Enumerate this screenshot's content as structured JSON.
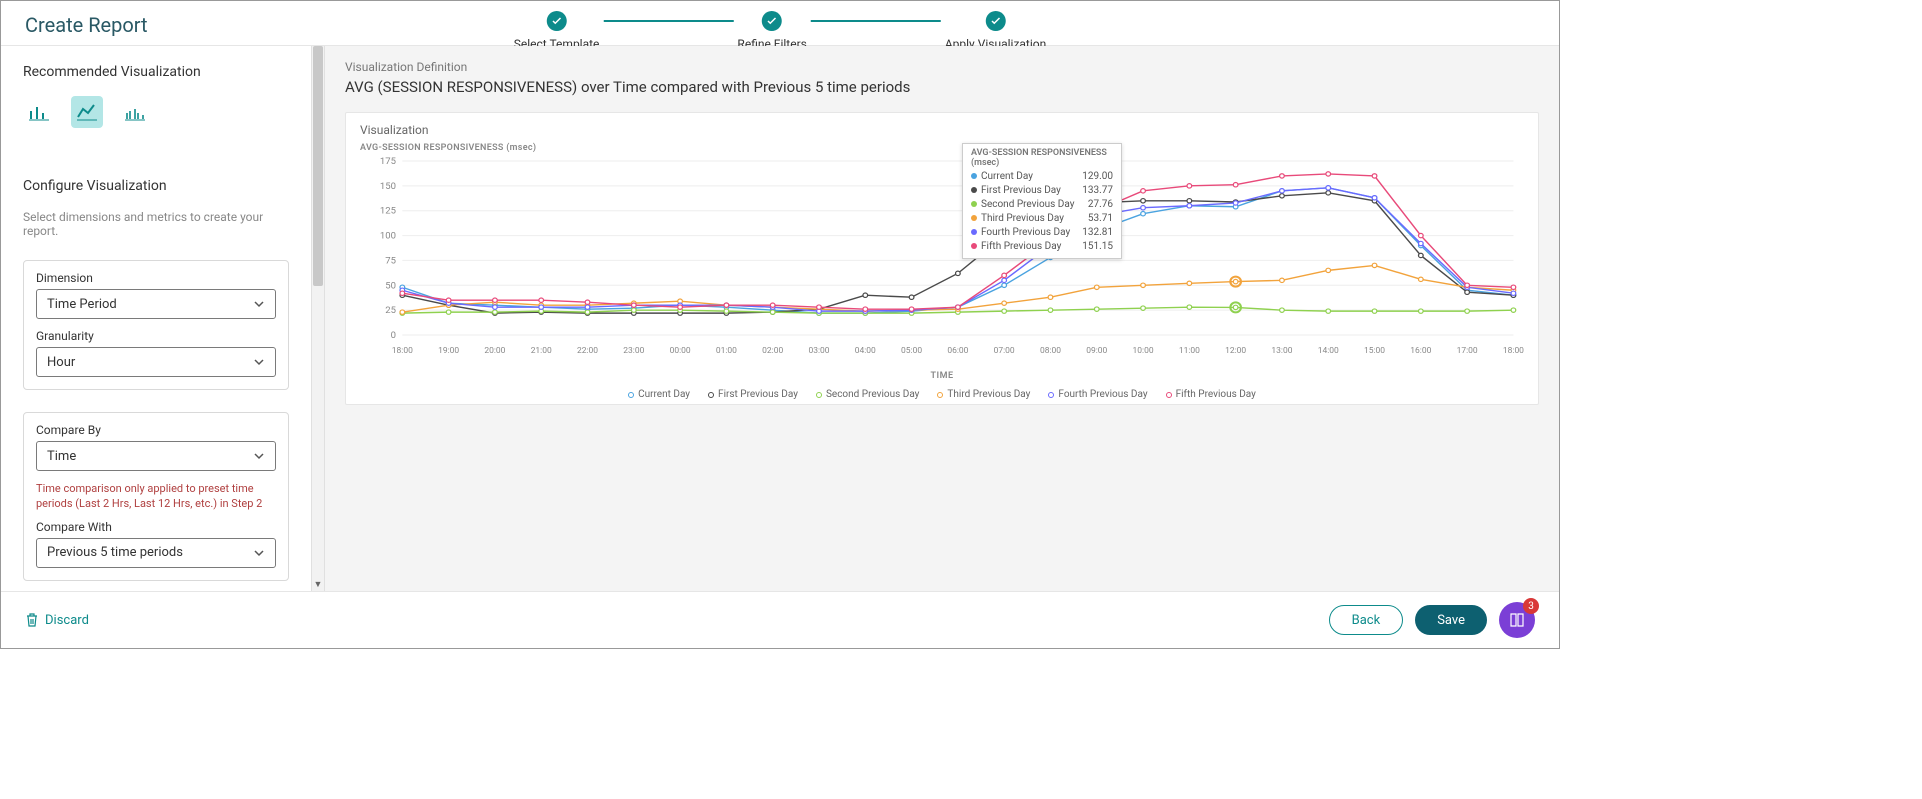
{
  "header": {
    "title": "Create Report",
    "steps": [
      "Select Template",
      "Refine Filters",
      "Apply Visualization"
    ]
  },
  "sidebar": {
    "recommended_label": "Recommended Visualization",
    "configure_heading": "Configure Visualization",
    "configure_sub": "Select dimensions and metrics to create your report.",
    "dimension_label": "Dimension",
    "dimension_value": "Time Period",
    "granularity_label": "Granularity",
    "granularity_value": "Hour",
    "compare_by_label": "Compare By",
    "compare_by_value": "Time",
    "warn_text": "Time comparison only applied to preset time periods (Last 2 Hrs, Last 12 Hrs, etc.) in Step 2",
    "compare_with_label": "Compare With",
    "compare_with_value": "Previous 5 time periods"
  },
  "main": {
    "def_label": "Visualization Definition",
    "def_text": "AVG (SESSION RESPONSIVENESS) over Time compared with Previous 5 time periods",
    "viz_label": "Visualization",
    "y_axis": "AVG-SESSION RESPONSIVENESS (msec)",
    "x_axis": "TIME"
  },
  "tooltip": {
    "title": "AVG-SESSION RESPONSIVENESS (msec)",
    "rows": [
      {
        "label": "Current Day",
        "value": "129.00"
      },
      {
        "label": "First Previous Day",
        "value": "133.77"
      },
      {
        "label": "Second Previous Day",
        "value": "27.76"
      },
      {
        "label": "Third Previous Day",
        "value": "53.71"
      },
      {
        "label": "Fourth Previous Day",
        "value": "132.81"
      },
      {
        "label": "Fifth Previous Day",
        "value": "151.15"
      }
    ]
  },
  "legend": [
    "Current Day",
    "First Previous Day",
    "Second Previous Day",
    "Third Previous Day",
    "Fourth Previous Day",
    "Fifth Previous Day"
  ],
  "footer": {
    "discard": "Discard",
    "back": "Back",
    "save": "Save",
    "badge": "3"
  },
  "colors": {
    "current": "#4aa3e0",
    "first": "#4a4a4a",
    "second": "#8fd14f",
    "third": "#f2a33c",
    "fourth": "#6a6aff",
    "fifth": "#e84a7a"
  },
  "chart_data": {
    "type": "line",
    "title": "",
    "xlabel": "TIME",
    "ylabel": "AVG-SESSION RESPONSIVENESS (msec)",
    "ylim": [
      0,
      175
    ],
    "y_ticks": [
      0,
      25,
      50,
      75,
      100,
      125,
      150,
      175
    ],
    "categories": [
      "18:00",
      "19:00",
      "20:00",
      "21:00",
      "22:00",
      "23:00",
      "00:00",
      "01:00",
      "02:00",
      "03:00",
      "04:00",
      "05:00",
      "06:00",
      "07:00",
      "08:00",
      "09:00",
      "10:00",
      "11:00",
      "12:00",
      "13:00",
      "14:00",
      "15:00",
      "16:00",
      "17:00",
      "18:00"
    ],
    "series": [
      {
        "name": "Current Day",
        "color_key": "current",
        "values": [
          48,
          32,
          30,
          28,
          26,
          27,
          30,
          28,
          25,
          22,
          22,
          24,
          28,
          50,
          78,
          105,
          122,
          130,
          129,
          145,
          148,
          138,
          90,
          45,
          40
        ]
      },
      {
        "name": "First Previous Day",
        "color_key": "first",
        "values": [
          40,
          30,
          22,
          23,
          22,
          22,
          22,
          22,
          23,
          26,
          40,
          38,
          62,
          100,
          125,
          133,
          135,
          135,
          133.77,
          140,
          143,
          135,
          80,
          43,
          40
        ]
      },
      {
        "name": "Second Previous Day",
        "color_key": "second",
        "values": [
          22,
          23,
          23,
          24,
          23,
          25,
          25,
          24,
          23,
          22,
          22,
          22,
          23,
          24,
          25,
          26,
          27,
          28,
          27.76,
          25,
          24,
          24,
          24,
          24,
          25
        ]
      },
      {
        "name": "Third Previous Day",
        "color_key": "third",
        "values": [
          23,
          30,
          33,
          30,
          30,
          32,
          34,
          30,
          28,
          26,
          24,
          25,
          26,
          32,
          38,
          48,
          50,
          52,
          53.71,
          55,
          65,
          70,
          56,
          48,
          45
        ]
      },
      {
        "name": "Fourth Previous Day",
        "color_key": "fourth",
        "values": [
          45,
          32,
          28,
          28,
          28,
          30,
          30,
          30,
          28,
          24,
          24,
          25,
          28,
          55,
          90,
          120,
          128,
          130,
          132.81,
          145,
          148,
          138,
          92,
          48,
          42
        ]
      },
      {
        "name": "Fifth Previous Day",
        "color_key": "fifth",
        "values": [
          42,
          35,
          35,
          35,
          33,
          30,
          28,
          30,
          30,
          28,
          26,
          26,
          28,
          60,
          95,
          125,
          145,
          150,
          151.15,
          160,
          162,
          160,
          100,
          50,
          48
        ]
      }
    ]
  }
}
